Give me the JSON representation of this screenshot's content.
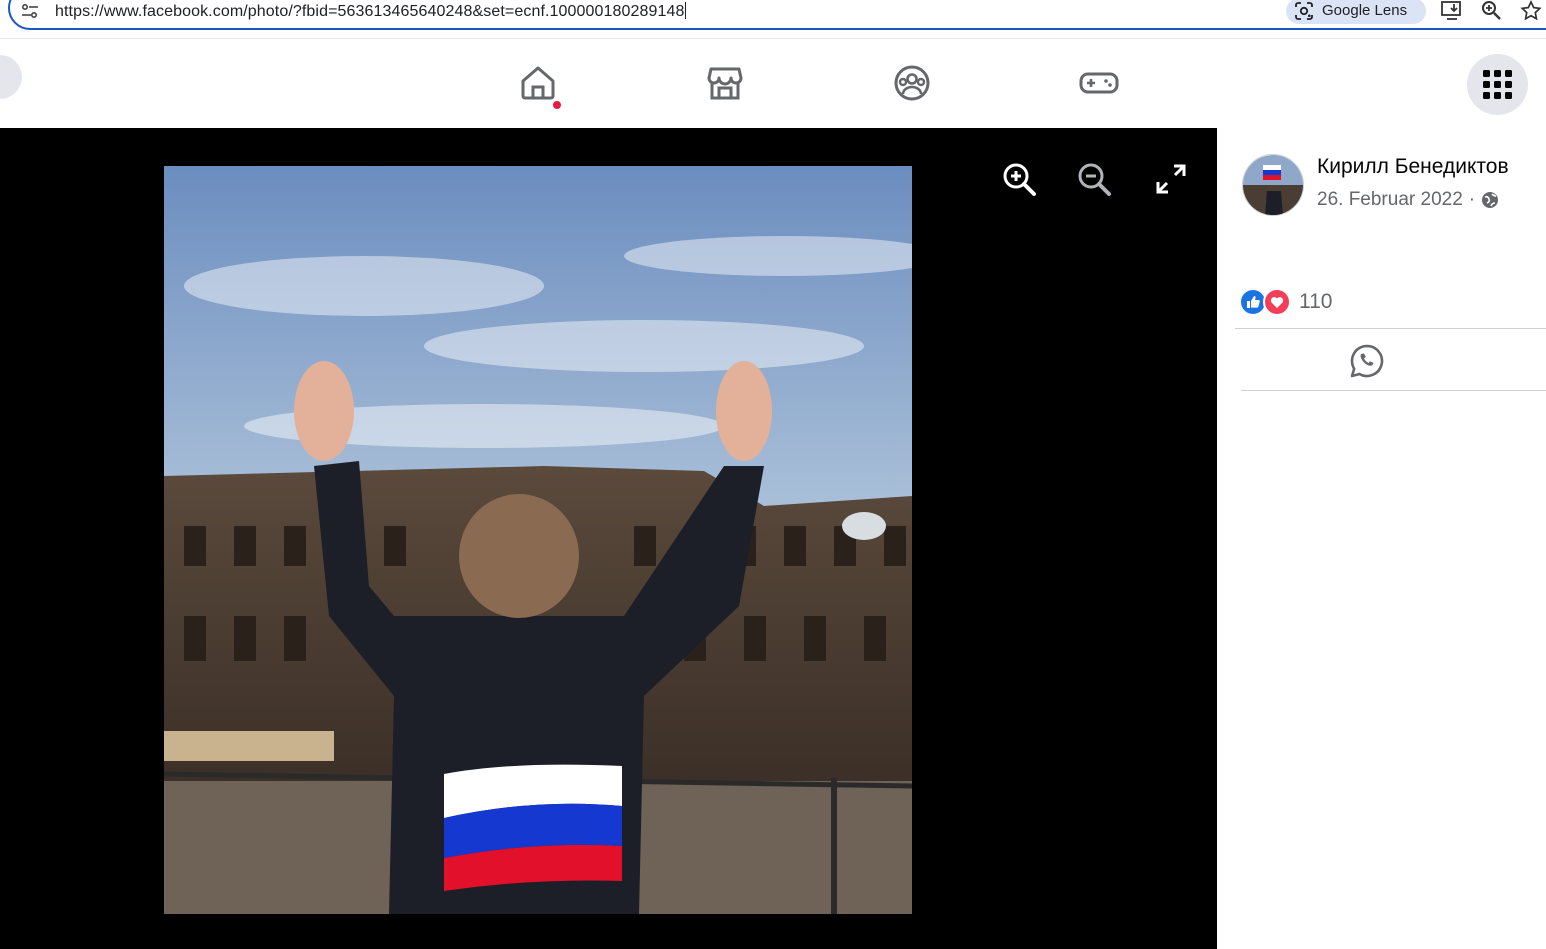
{
  "browser": {
    "url": "https://www.facebook.com/photo/?fbid=563613465640248&set=ecnf.100000180289148",
    "lens_label": "Google Lens"
  },
  "nav": {
    "icons": [
      "home-icon",
      "marketplace-icon",
      "groups-icon",
      "gaming-icon",
      "menu-grid-icon"
    ],
    "home_has_notification": true
  },
  "viewer": {
    "controls": [
      "zoom-in-icon",
      "zoom-out-icon",
      "fullscreen-icon"
    ]
  },
  "post": {
    "author": "Кирилл Бенедиктов",
    "date": "26. Februar 2022",
    "separator": "·",
    "privacy_icon": "globe-icon",
    "reaction_count": "110",
    "reaction_types": [
      "like",
      "love"
    ]
  },
  "colors": {
    "accent": "#1b74e4",
    "love": "#f33e58",
    "notification": "#e41e3f"
  }
}
